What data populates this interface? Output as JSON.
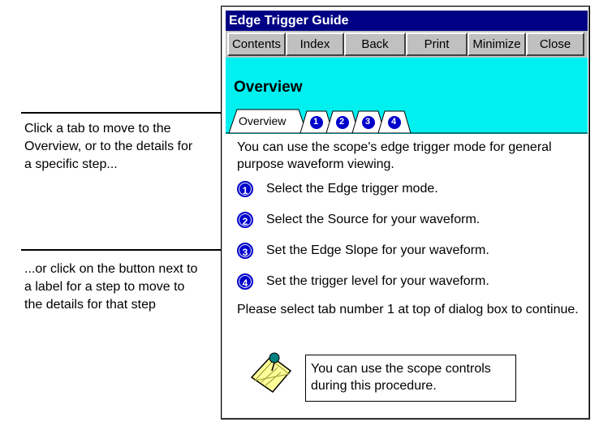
{
  "callouts": {
    "tabs_text": "Click a tab to move to the Overview, or to the details for a specific step...",
    "buttons_text": "...or click on the button next to a label for a step to move to the details for that step"
  },
  "window": {
    "title": "Edge Trigger Guide",
    "buttons": [
      {
        "label": "Contents",
        "icon": "",
        "name": "contents-button"
      },
      {
        "label": "Index",
        "name": "index-button"
      },
      {
        "label": "Back",
        "name": "back-button"
      },
      {
        "label": "Print",
        "name": "print-button"
      },
      {
        "label": "Minimize",
        "name": "minimize-button"
      },
      {
        "label": "Close",
        "name": "close-button"
      }
    ],
    "header_title": "Overview",
    "tabs": {
      "overview_label": "Overview",
      "step_tabs": [
        "1",
        "2",
        "3",
        "4"
      ]
    },
    "intro": "You can use the scope's edge trigger mode for general purpose waveform viewing.",
    "steps": [
      {
        "num": "1",
        "text": "Select the Edge trigger mode."
      },
      {
        "num": "2",
        "text": "Select the Source for your waveform."
      },
      {
        "num": "3",
        "text": "Set the Edge Slope for your waveform."
      },
      {
        "num": "4",
        "text": "Set the trigger level for your waveform."
      }
    ],
    "footer": "Please select tab number 1 at top of dialog box to continue.",
    "note": {
      "icon": "notepad-pin-icon",
      "text": "You can use the scope controls during this procedure."
    }
  },
  "colors": {
    "titlebar": "#000084",
    "header": "#00f0f0",
    "step_button": "#0000cc"
  }
}
